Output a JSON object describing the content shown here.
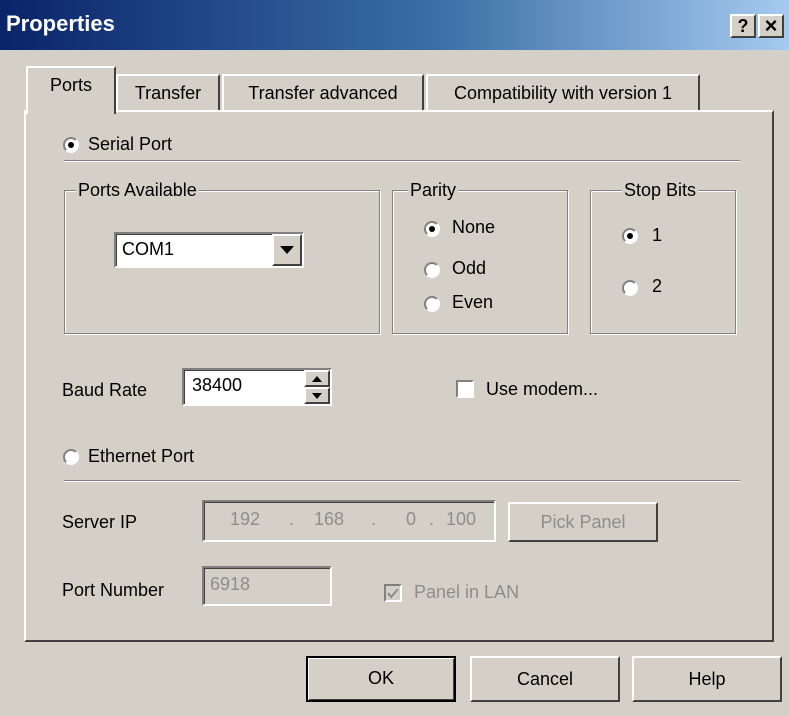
{
  "window": {
    "title": "Properties",
    "help_label": "?",
    "close_label": "×"
  },
  "tabs": [
    {
      "label": "Ports",
      "active": true
    },
    {
      "label": "Transfer",
      "active": false
    },
    {
      "label": "Transfer advanced",
      "active": false
    },
    {
      "label": "Compatibility with version 1",
      "active": false
    }
  ],
  "serial": {
    "label": "Serial Port",
    "selected": true
  },
  "ports_available": {
    "legend": "Ports Available",
    "value": "COM1"
  },
  "parity": {
    "legend": "Parity",
    "options": [
      "None",
      "Odd",
      "Even"
    ],
    "selected": "None"
  },
  "stop_bits": {
    "legend": "Stop Bits",
    "options": [
      "1",
      "2"
    ],
    "selected": "1"
  },
  "baud": {
    "label": "Baud Rate",
    "value": "38400"
  },
  "modem": {
    "label": "Use modem...",
    "checked": false
  },
  "ethernet": {
    "label": "Ethernet Port",
    "selected": false
  },
  "server_ip": {
    "label": "Server IP",
    "octets": [
      "192",
      "168",
      "0",
      "100"
    ],
    "separator": "."
  },
  "pick_panel": {
    "label": "Pick Panel"
  },
  "port_number": {
    "label": "Port Number",
    "value": "6918"
  },
  "panel_in_lan": {
    "label": "Panel in LAN",
    "checked": true
  },
  "footer": {
    "ok": "OK",
    "cancel": "Cancel",
    "help": "Help"
  },
  "colors": {
    "titlebar_start": "#0a246a",
    "titlebar_end": "#a6caf0",
    "face": "#d4d0c8",
    "disabled_text": "#8d8d8d"
  }
}
